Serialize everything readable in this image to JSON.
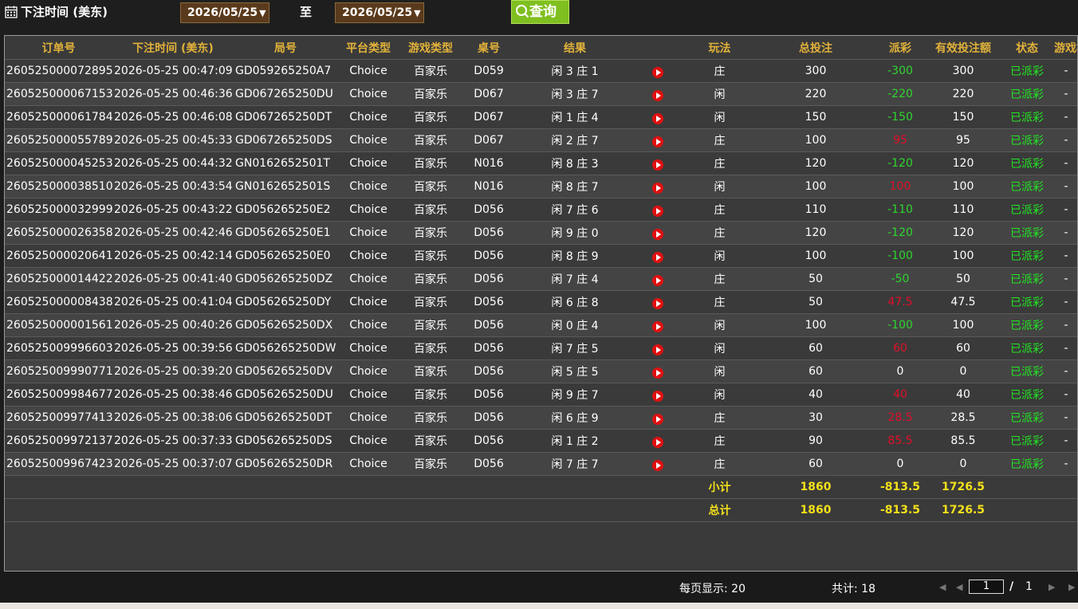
{
  "filter": {
    "label": "下注时间 (美东)",
    "date_from": "2026/05/25",
    "to_label": "至",
    "date_to": "2026/05/25",
    "query_label": "查询"
  },
  "table": {
    "columns": [
      "订单号",
      "下注时间 (美东)",
      "局号",
      "平台类型",
      "游戏类型",
      "桌号",
      "结果",
      "",
      "玩法",
      "总投注",
      "派彩",
      "有效投注额",
      "状态",
      "游戏模式"
    ],
    "rows": [
      {
        "order": "260525000072895",
        "time": "2026-05-25 00:47:09",
        "round": "GD059265250A7",
        "platform": "Choice",
        "game": "百家乐",
        "table": "D059",
        "result": "闲 3 庄 1",
        "play": "庄",
        "bet": "300",
        "payout": "-300",
        "payout_sign": "neg",
        "valid": "300",
        "status": "已派彩",
        "mode": "-"
      },
      {
        "order": "260525000067153",
        "time": "2026-05-25 00:46:36",
        "round": "GD067265250DU",
        "platform": "Choice",
        "game": "百家乐",
        "table": "D067",
        "result": "闲 3 庄 7",
        "play": "闲",
        "bet": "220",
        "payout": "-220",
        "payout_sign": "neg",
        "valid": "220",
        "status": "已派彩",
        "mode": "-"
      },
      {
        "order": "260525000061784",
        "time": "2026-05-25 00:46:08",
        "round": "GD067265250DT",
        "platform": "Choice",
        "game": "百家乐",
        "table": "D067",
        "result": "闲 1 庄 4",
        "play": "闲",
        "bet": "150",
        "payout": "-150",
        "payout_sign": "neg",
        "valid": "150",
        "status": "已派彩",
        "mode": "-"
      },
      {
        "order": "260525000055789",
        "time": "2026-05-25 00:45:33",
        "round": "GD067265250DS",
        "platform": "Choice",
        "game": "百家乐",
        "table": "D067",
        "result": "闲 2 庄 7",
        "play": "庄",
        "bet": "100",
        "payout": "95",
        "payout_sign": "pos",
        "valid": "95",
        "status": "已派彩",
        "mode": "-"
      },
      {
        "order": "260525000045253",
        "time": "2026-05-25 00:44:32",
        "round": "GN0162652501T",
        "platform": "Choice",
        "game": "百家乐",
        "table": "N016",
        "result": "闲 8 庄 3",
        "play": "庄",
        "bet": "120",
        "payout": "-120",
        "payout_sign": "neg",
        "valid": "120",
        "status": "已派彩",
        "mode": "-"
      },
      {
        "order": "260525000038510",
        "time": "2026-05-25 00:43:54",
        "round": "GN0162652501S",
        "platform": "Choice",
        "game": "百家乐",
        "table": "N016",
        "result": "闲 8 庄 7",
        "play": "闲",
        "bet": "100",
        "payout": "100",
        "payout_sign": "pos",
        "valid": "100",
        "status": "已派彩",
        "mode": "-"
      },
      {
        "order": "260525000032999",
        "time": "2026-05-25 00:43:22",
        "round": "GD056265250E2",
        "platform": "Choice",
        "game": "百家乐",
        "table": "D056",
        "result": "闲 7 庄 6",
        "play": "庄",
        "bet": "110",
        "payout": "-110",
        "payout_sign": "neg",
        "valid": "110",
        "status": "已派彩",
        "mode": "-"
      },
      {
        "order": "260525000026358",
        "time": "2026-05-25 00:42:46",
        "round": "GD056265250E1",
        "platform": "Choice",
        "game": "百家乐",
        "table": "D056",
        "result": "闲 9 庄 0",
        "play": "庄",
        "bet": "120",
        "payout": "-120",
        "payout_sign": "neg",
        "valid": "120",
        "status": "已派彩",
        "mode": "-"
      },
      {
        "order": "260525000020641",
        "time": "2026-05-25 00:42:14",
        "round": "GD056265250E0",
        "platform": "Choice",
        "game": "百家乐",
        "table": "D056",
        "result": "闲 8 庄 9",
        "play": "闲",
        "bet": "100",
        "payout": "-100",
        "payout_sign": "neg",
        "valid": "100",
        "status": "已派彩",
        "mode": "-"
      },
      {
        "order": "260525000014422",
        "time": "2026-05-25 00:41:40",
        "round": "GD056265250DZ",
        "platform": "Choice",
        "game": "百家乐",
        "table": "D056",
        "result": "闲 7 庄 4",
        "play": "庄",
        "bet": "50",
        "payout": "-50",
        "payout_sign": "neg",
        "valid": "50",
        "status": "已派彩",
        "mode": "-"
      },
      {
        "order": "260525000008438",
        "time": "2026-05-25 00:41:04",
        "round": "GD056265250DY",
        "platform": "Choice",
        "game": "百家乐",
        "table": "D056",
        "result": "闲 6 庄 8",
        "play": "庄",
        "bet": "50",
        "payout": "47.5",
        "payout_sign": "pos",
        "valid": "47.5",
        "status": "已派彩",
        "mode": "-"
      },
      {
        "order": "260525000001561",
        "time": "2026-05-25 00:40:26",
        "round": "GD056265250DX",
        "platform": "Choice",
        "game": "百家乐",
        "table": "D056",
        "result": "闲 0 庄 4",
        "play": "闲",
        "bet": "100",
        "payout": "-100",
        "payout_sign": "neg",
        "valid": "100",
        "status": "已派彩",
        "mode": "-"
      },
      {
        "order": "260525009996603",
        "time": "2026-05-25 00:39:56",
        "round": "GD056265250DW",
        "platform": "Choice",
        "game": "百家乐",
        "table": "D056",
        "result": "闲 7 庄 5",
        "play": "闲",
        "bet": "60",
        "payout": "60",
        "payout_sign": "pos",
        "valid": "60",
        "status": "已派彩",
        "mode": "-"
      },
      {
        "order": "260525009990771",
        "time": "2026-05-25 00:39:20",
        "round": "GD056265250DV",
        "platform": "Choice",
        "game": "百家乐",
        "table": "D056",
        "result": "闲 5 庄 5",
        "play": "闲",
        "bet": "60",
        "payout": "0",
        "payout_sign": "zero",
        "valid": "0",
        "status": "已派彩",
        "mode": "-"
      },
      {
        "order": "260525009984677",
        "time": "2026-05-25 00:38:46",
        "round": "GD056265250DU",
        "platform": "Choice",
        "game": "百家乐",
        "table": "D056",
        "result": "闲 9 庄 7",
        "play": "闲",
        "bet": "40",
        "payout": "40",
        "payout_sign": "pos",
        "valid": "40",
        "status": "已派彩",
        "mode": "-"
      },
      {
        "order": "260525009977413",
        "time": "2026-05-25 00:38:06",
        "round": "GD056265250DT",
        "platform": "Choice",
        "game": "百家乐",
        "table": "D056",
        "result": "闲 6 庄 9",
        "play": "庄",
        "bet": "30",
        "payout": "28.5",
        "payout_sign": "pos",
        "valid": "28.5",
        "status": "已派彩",
        "mode": "-"
      },
      {
        "order": "260525009972137",
        "time": "2026-05-25 00:37:33",
        "round": "GD056265250DS",
        "platform": "Choice",
        "game": "百家乐",
        "table": "D056",
        "result": "闲 1 庄 2",
        "play": "庄",
        "bet": "90",
        "payout": "85.5",
        "payout_sign": "pos",
        "valid": "85.5",
        "status": "已派彩",
        "mode": "-"
      },
      {
        "order": "260525009967423",
        "time": "2026-05-25 00:37:07",
        "round": "GD056265250DR",
        "platform": "Choice",
        "game": "百家乐",
        "table": "D056",
        "result": "闲 7 庄 7",
        "play": "庄",
        "bet": "60",
        "payout": "0",
        "payout_sign": "zero",
        "valid": "0",
        "status": "已派彩",
        "mode": "-"
      }
    ],
    "subtotal": {
      "label": "小计",
      "bet": "1860",
      "payout": "-813.5",
      "valid": "1726.5"
    },
    "total": {
      "label": "总计",
      "bet": "1860",
      "payout": "-813.5",
      "valid": "1726.5"
    }
  },
  "footer": {
    "per_page": "每页显示: 20",
    "total_count": "共计: 18",
    "current_page": "1",
    "slash": "/",
    "total_pages": "1"
  },
  "colors": {
    "header_text": "#e2b23a",
    "negative_payout": "#2ed62e",
    "positive_payout": "#e0102a",
    "status_text": "#22e622",
    "sum_text": "#f2e01a",
    "query_button": "#7fbf1f"
  }
}
